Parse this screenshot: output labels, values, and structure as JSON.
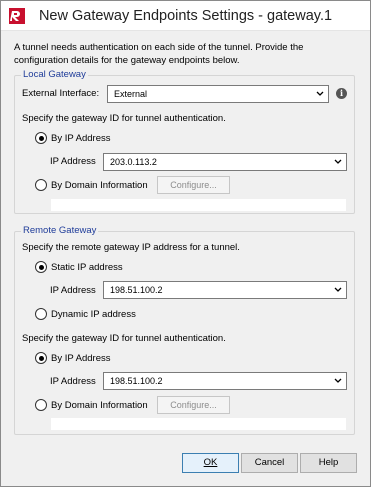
{
  "window": {
    "title": "New Gateway Endpoints Settings - gateway.1"
  },
  "intro": "A tunnel needs authentication on each side of the tunnel. Provide the configuration details for the gateway endpoints below.",
  "local_gateway": {
    "group_label": "Local Gateway",
    "external_interface_label": "External Interface:",
    "external_interface_value": "External",
    "auth_prompt": "Specify the gateway ID for tunnel authentication.",
    "by_ip_label": "By IP Address",
    "by_ip_selected": true,
    "ip_address_label": "IP Address",
    "ip_address_value": "203.0.113.2",
    "by_domain_label": "By Domain Information",
    "configure_label": "Configure..."
  },
  "remote_gateway": {
    "group_label": "Remote Gateway",
    "ip_prompt": "Specify the remote gateway IP address for a tunnel.",
    "static_ip_label": "Static IP address",
    "static_ip_selected": true,
    "ip_address_label": "IP Address",
    "ip_address_value": "198.51.100.2",
    "dynamic_ip_label": "Dynamic IP address",
    "auth_prompt": "Specify the gateway ID for tunnel authentication.",
    "by_ip_label": "By IP Address",
    "by_ip_selected": true,
    "auth_ip_address_label": "IP Address",
    "auth_ip_address_value": "198.51.100.2",
    "by_domain_label": "By Domain Information",
    "configure_label": "Configure..."
  },
  "buttons": {
    "ok": "OK",
    "cancel": "Cancel",
    "help": "Help"
  },
  "colors": {
    "group_label": "#1f3c99",
    "app_icon": "#c8102e"
  }
}
